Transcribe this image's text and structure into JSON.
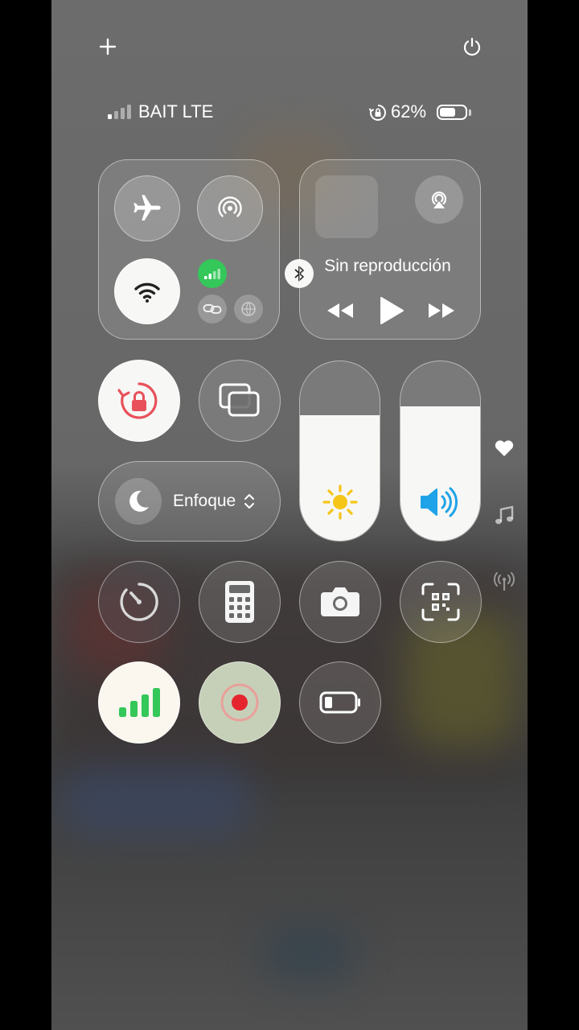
{
  "status_bar": {
    "carrier": "BAIT LTE",
    "battery_percent": "62%",
    "battery_level": 0.62
  },
  "media": {
    "status": "Sin reproducción"
  },
  "focus": {
    "label": "Enfoque"
  },
  "sliders": {
    "brightness_level": 0.7,
    "volume_level": 0.75
  },
  "colors": {
    "accent_green": "#34c759",
    "lock_red": "#e8515a",
    "record_red": "#e5252e",
    "sun_yellow": "#f5c518",
    "speaker_blue": "#1fa3e8"
  },
  "icons": [
    "plus-icon",
    "power-icon",
    "airplane-icon",
    "airdrop-icon",
    "wifi-icon",
    "cellular-icon",
    "bluetooth-icon",
    "link-icon",
    "vpn-icon",
    "airplay-icon",
    "rewind-icon",
    "play-icon",
    "forward-icon",
    "rotation-lock-icon",
    "screen-mirroring-icon",
    "moon-icon",
    "sun-icon",
    "speaker-icon",
    "timer-icon",
    "calculator-icon",
    "camera-icon",
    "qr-code-icon",
    "signal-bars-icon",
    "screen-record-icon",
    "low-power-icon",
    "heart-icon",
    "music-note-icon",
    "antenna-icon"
  ]
}
